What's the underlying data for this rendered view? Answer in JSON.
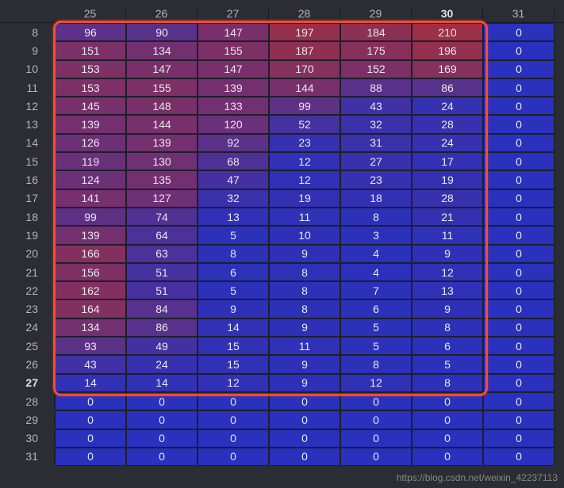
{
  "chart_data": {
    "type": "heatmap",
    "col_headers": [
      "25",
      "26",
      "27",
      "28",
      "29",
      "30",
      "31"
    ],
    "row_headers": [
      "8",
      "9",
      "10",
      "11",
      "12",
      "13",
      "14",
      "15",
      "16",
      "17",
      "18",
      "19",
      "20",
      "21",
      "22",
      "23",
      "24",
      "25",
      "26",
      "27",
      "28",
      "29",
      "30",
      "31"
    ],
    "highlight_col": "30",
    "highlight_row": "27",
    "cells": [
      [
        96,
        90,
        147,
        197,
        184,
        210,
        0
      ],
      [
        151,
        134,
        155,
        187,
        175,
        196,
        0
      ],
      [
        153,
        147,
        147,
        170,
        152,
        169,
        0
      ],
      [
        153,
        155,
        139,
        144,
        88,
        86,
        0
      ],
      [
        145,
        148,
        133,
        99,
        43,
        24,
        0
      ],
      [
        139,
        144,
        120,
        52,
        32,
        28,
        0
      ],
      [
        126,
        139,
        92,
        23,
        31,
        24,
        0
      ],
      [
        119,
        130,
        68,
        12,
        27,
        17,
        0
      ],
      [
        124,
        135,
        47,
        12,
        23,
        19,
        0
      ],
      [
        141,
        127,
        32,
        19,
        18,
        28,
        0
      ],
      [
        99,
        74,
        13,
        11,
        8,
        21,
        0
      ],
      [
        139,
        64,
        5,
        10,
        3,
        11,
        0
      ],
      [
        166,
        63,
        8,
        9,
        4,
        9,
        0
      ],
      [
        156,
        51,
        6,
        8,
        4,
        12,
        0
      ],
      [
        162,
        51,
        5,
        8,
        7,
        13,
        0
      ],
      [
        164,
        84,
        9,
        8,
        6,
        9,
        0
      ],
      [
        134,
        86,
        14,
        9,
        5,
        8,
        0
      ],
      [
        93,
        49,
        15,
        11,
        5,
        6,
        0
      ],
      [
        43,
        24,
        15,
        9,
        8,
        5,
        0
      ],
      [
        14,
        14,
        12,
        9,
        12,
        8,
        0
      ],
      [
        0,
        0,
        0,
        0,
        0,
        0,
        0
      ],
      [
        0,
        0,
        0,
        0,
        0,
        0,
        0
      ],
      [
        0,
        0,
        0,
        0,
        0,
        0,
        0
      ],
      [
        0,
        0,
        0,
        0,
        0,
        0,
        0
      ]
    ],
    "value_min": 0,
    "value_max": 210
  },
  "selection": {
    "row_start": "8",
    "row_end": "27",
    "col_start": "25",
    "col_end": "30"
  },
  "watermark": "https://blog.csdn.net/weixin_42237113"
}
